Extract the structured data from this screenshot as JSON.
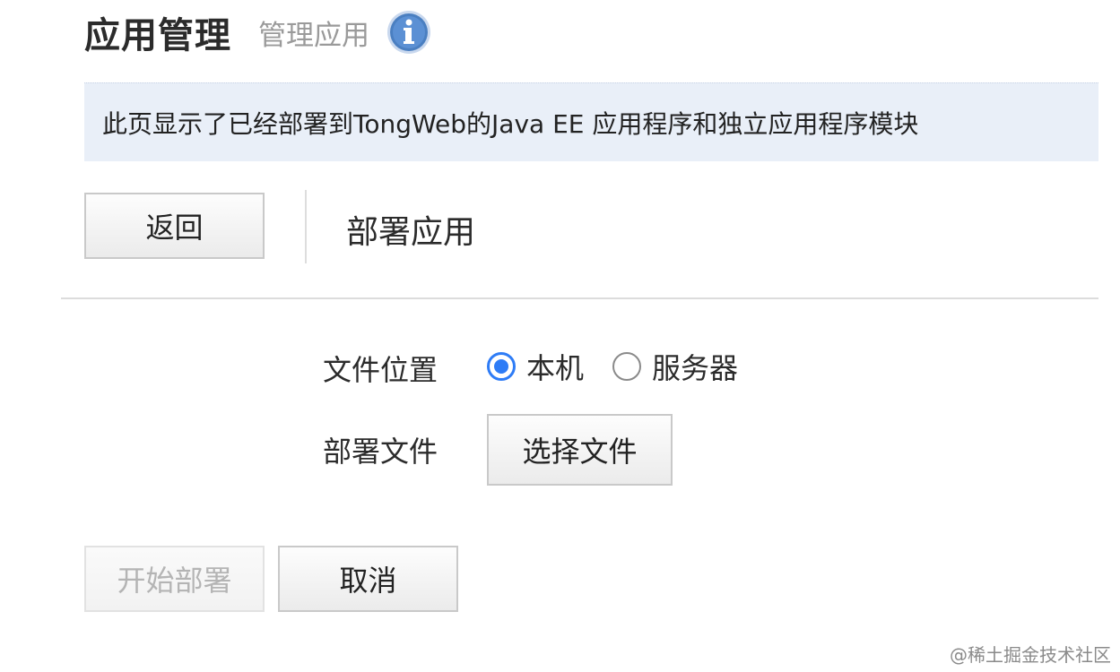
{
  "header": {
    "title": "应用管理",
    "subtitle": "管理应用",
    "info_icon": "info-icon"
  },
  "banner": {
    "text": "此页显示了已经部署到TongWeb的Java EE 应用程序和独立应用程序模块"
  },
  "toolbar": {
    "back_label": "返回",
    "section_title": "部署应用"
  },
  "form": {
    "location_label": "文件位置",
    "location_options": [
      {
        "label": "本机",
        "checked": true
      },
      {
        "label": "服务器",
        "checked": false
      }
    ],
    "file_label": "部署文件",
    "choose_file_label": "选择文件"
  },
  "actions": {
    "start_label": "开始部署",
    "start_disabled": true,
    "cancel_label": "取消"
  },
  "watermark": "@稀土掘金技术社区",
  "colors": {
    "accent": "#2e7cf6",
    "banner_bg": "#e9eff8",
    "info_icon": "#4a7fc1"
  }
}
